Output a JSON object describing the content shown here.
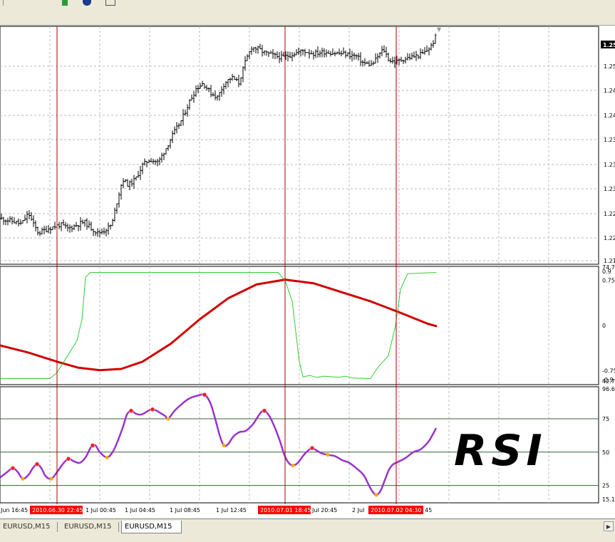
{
  "colors": {
    "price_bars": "#000000",
    "vline": "#b00000",
    "grid": "#b8b8b8",
    "signal_red": "#d00000",
    "signal_green": "#33cc33",
    "rsi_line": "#9933cc",
    "rsi_level": "#336633",
    "peak_marker": "#ee2222",
    "trough_marker": "#ffaa00",
    "date_highlight": "#ff0000"
  },
  "tabs": [
    {
      "label": "EURUSD,M15",
      "active": false
    },
    {
      "label": "EURUSD,M15",
      "active": false
    },
    {
      "label": "EURUSD,M15",
      "active": true
    }
  ],
  "annotation_text": "RSI",
  "chart_data": [
    {
      "type": "ohlc",
      "panel": "price",
      "y_tick_labels": [
        "1.25",
        "1.25",
        "1.24",
        "1.24",
        "1.23",
        "1.23",
        "1.23",
        "1.22",
        "1.22",
        "1.21"
      ],
      "last_price_label": "1.25",
      "x_ticks": [
        {
          "label": "Jun 16:45",
          "highlight": false
        },
        {
          "label": "2010.06.30 22:45",
          "highlight": true
        },
        {
          "label": "1 Jul 00:45",
          "highlight": false
        },
        {
          "label": "1 Jul 04:45",
          "highlight": false
        },
        {
          "label": "1 Jul 08:45",
          "highlight": false
        },
        {
          "label": "1 Jul 12:45",
          "highlight": false
        },
        {
          "label": "2010.07.01 18:45",
          "highlight": true
        },
        {
          "label": "Jul 20:45",
          "highlight": false
        },
        {
          "label": "2 Jul",
          "highlight": false
        },
        {
          "label": "2010.07.02 04:30",
          "highlight": true
        },
        {
          "label": "45",
          "highlight": false
        }
      ],
      "ylim": [
        1.2125,
        1.2545
      ],
      "close_path": [
        [
          0,
          1.2206
        ],
        [
          10,
          1.2203
        ],
        [
          20,
          1.22
        ],
        [
          30,
          1.2196
        ],
        [
          40,
          1.2215
        ],
        [
          47,
          1.2195
        ],
        [
          54,
          1.218
        ],
        [
          62,
          1.2185
        ],
        [
          72,
          1.219
        ],
        [
          85,
          1.2195
        ],
        [
          95,
          1.2188
        ],
        [
          105,
          1.2193
        ],
        [
          118,
          1.22
        ],
        [
          127,
          1.219
        ],
        [
          137,
          1.218
        ],
        [
          147,
          1.2185
        ],
        [
          157,
          1.2195
        ],
        [
          163,
          1.223
        ],
        [
          172,
          1.2275
        ],
        [
          180,
          1.2265
        ],
        [
          190,
          1.2275
        ],
        [
          200,
          1.23
        ],
        [
          210,
          1.231
        ],
        [
          222,
          1.2305
        ],
        [
          233,
          1.233
        ],
        [
          243,
          1.2355
        ],
        [
          255,
          1.238
        ],
        [
          265,
          1.241
        ],
        [
          275,
          1.2435
        ],
        [
          285,
          1.2445
        ],
        [
          295,
          1.2428
        ],
        [
          305,
          1.242
        ],
        [
          315,
          1.2445
        ],
        [
          325,
          1.2455
        ],
        [
          335,
          1.2445
        ],
        [
          345,
          1.2485
        ],
        [
          353,
          1.2508
        ],
        [
          362,
          1.2505
        ],
        [
          372,
          1.2498
        ],
        [
          385,
          1.2493
        ],
        [
          397,
          1.249
        ],
        [
          410,
          1.2496
        ],
        [
          425,
          1.2502
        ],
        [
          440,
          1.2497
        ],
        [
          455,
          1.25
        ],
        [
          470,
          1.2498
        ],
        [
          485,
          1.2496
        ],
        [
          500,
          1.2492
        ],
        [
          510,
          1.248
        ],
        [
          522,
          1.2477
        ],
        [
          532,
          1.2495
        ],
        [
          538,
          1.2505
        ],
        [
          546,
          1.2485
        ],
        [
          556,
          1.2482
        ],
        [
          565,
          1.2487
        ],
        [
          575,
          1.249
        ],
        [
          585,
          1.2493
        ],
        [
          595,
          1.2498
        ],
        [
          605,
          1.251
        ],
        [
          612,
          1.2528
        ]
      ]
    },
    {
      "type": "line",
      "panel": "signal",
      "y_tick_labels": [
        "74.7",
        "0.9",
        "0.75",
        "0",
        "-0.75",
        "-0.9",
        "42.7"
      ],
      "ylim": [
        -0.98,
        0.98
      ],
      "series": [
        {
          "color": "#d00000",
          "points": [
            [
              0,
              -0.33
            ],
            [
              40,
              -0.45
            ],
            [
              80,
              -0.6
            ],
            [
              110,
              -0.7
            ],
            [
              140,
              -0.74
            ],
            [
              170,
              -0.72
            ],
            [
              200,
              -0.6
            ],
            [
              240,
              -0.3
            ],
            [
              280,
              0.1
            ],
            [
              320,
              0.45
            ],
            [
              360,
              0.68
            ],
            [
              400,
              0.76
            ],
            [
              440,
              0.7
            ],
            [
              480,
              0.55
            ],
            [
              520,
              0.4
            ],
            [
              560,
              0.22
            ],
            [
              600,
              0.03
            ],
            [
              612,
              -0.01
            ]
          ]
        },
        {
          "color": "#33cc33",
          "points": [
            [
              0,
              -0.88
            ],
            [
              70,
              -0.88
            ],
            [
              80,
              -0.78
            ],
            [
              95,
              -0.5
            ],
            [
              108,
              -0.25
            ],
            [
              115,
              0.1
            ],
            [
              120,
              0.8
            ],
            [
              127,
              0.88
            ],
            [
              390,
              0.88
            ],
            [
              400,
              0.75
            ],
            [
              410,
              0.4
            ],
            [
              420,
              -0.6
            ],
            [
              425,
              -0.85
            ],
            [
              435,
              -0.83
            ],
            [
              445,
              -0.86
            ],
            [
              455,
              -0.84
            ],
            [
              465,
              -0.85
            ],
            [
              475,
              -0.86
            ],
            [
              485,
              -0.84
            ],
            [
              495,
              -0.87
            ],
            [
              520,
              -0.88
            ],
            [
              530,
              -0.7
            ],
            [
              545,
              -0.5
            ],
            [
              555,
              0.0
            ],
            [
              562,
              0.6
            ],
            [
              572,
              0.86
            ],
            [
              612,
              0.88
            ]
          ]
        }
      ]
    },
    {
      "type": "line",
      "panel": "rsi",
      "y_tick_labels": [
        "96.6",
        "75",
        "50",
        "25",
        "15.1"
      ],
      "levels": [
        75,
        50,
        25
      ],
      "ylim": [
        12,
        99
      ],
      "series": [
        {
          "color": "#9933cc",
          "points": [
            [
              0,
              31
            ],
            [
              10,
              35
            ],
            [
              18,
              38
            ],
            [
              25,
              35
            ],
            [
              32,
              30
            ],
            [
              40,
              33
            ],
            [
              46,
              38
            ],
            [
              52,
              41
            ],
            [
              58,
              38
            ],
            [
              64,
              32
            ],
            [
              72,
              30
            ],
            [
              80,
              35
            ],
            [
              88,
              41
            ],
            [
              96,
              45
            ],
            [
              104,
              43
            ],
            [
              112,
              42
            ],
            [
              120,
              46
            ],
            [
              128,
              54
            ],
            [
              134,
              55
            ],
            [
              140,
              50
            ],
            [
              150,
              46
            ],
            [
              158,
              50
            ],
            [
              165,
              58
            ],
            [
              172,
              68
            ],
            [
              178,
              78
            ],
            [
              184,
              81
            ],
            [
              190,
              79
            ],
            [
              196,
              78
            ],
            [
              202,
              79
            ],
            [
              208,
              81
            ],
            [
              214,
              82
            ],
            [
              220,
              81
            ],
            [
              226,
              79
            ],
            [
              232,
              77
            ],
            [
              236,
              75
            ],
            [
              245,
              81
            ],
            [
              255,
              86
            ],
            [
              265,
              90
            ],
            [
              275,
              92
            ],
            [
              287,
              93
            ],
            [
              295,
              87
            ],
            [
              302,
              75
            ],
            [
              308,
              63
            ],
            [
              314,
              55
            ],
            [
              320,
              56
            ],
            [
              328,
              62
            ],
            [
              336,
              65
            ],
            [
              345,
              66
            ],
            [
              355,
              71
            ],
            [
              365,
              79
            ],
            [
              371,
              81
            ],
            [
              378,
              77
            ],
            [
              386,
              68
            ],
            [
              393,
              58
            ],
            [
              399,
              48
            ],
            [
              405,
              42
            ],
            [
              411,
              40
            ],
            [
              418,
              42
            ],
            [
              425,
              47
            ],
            [
              432,
              51
            ],
            [
              438,
              53
            ],
            [
              445,
              51
            ],
            [
              452,
              49
            ],
            [
              460,
              48
            ],
            [
              470,
              47
            ],
            [
              480,
              44
            ],
            [
              490,
              42
            ],
            [
              500,
              38
            ],
            [
              510,
              33
            ],
            [
              516,
              27
            ],
            [
              522,
              21
            ],
            [
              528,
              18
            ],
            [
              534,
              21
            ],
            [
              540,
              29
            ],
            [
              546,
              37
            ],
            [
              552,
              41
            ],
            [
              560,
              43
            ],
            [
              570,
              46
            ],
            [
              580,
              50
            ],
            [
              590,
              52
            ],
            [
              600,
              57
            ],
            [
              606,
              62
            ],
            [
              612,
              68
            ]
          ]
        }
      ],
      "peaks": [
        [
          18,
          38
        ],
        [
          52,
          41
        ],
        [
          96,
          45
        ],
        [
          130,
          55
        ],
        [
          184,
          81
        ],
        [
          214,
          82
        ],
        [
          287,
          93
        ],
        [
          371,
          81
        ],
        [
          438,
          53
        ]
      ],
      "troughs": [
        [
          32,
          30
        ],
        [
          72,
          30
        ],
        [
          150,
          46
        ],
        [
          236,
          75
        ],
        [
          314,
          55
        ],
        [
          411,
          40
        ],
        [
          460,
          48
        ],
        [
          528,
          18
        ]
      ]
    }
  ]
}
